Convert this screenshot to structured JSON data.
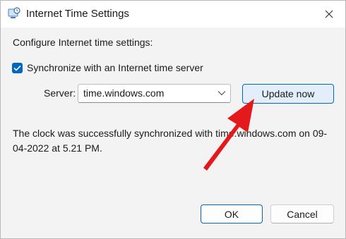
{
  "window": {
    "title": "Internet Time Settings",
    "close_icon": "close-icon",
    "app_icon": "clock-settings-icon"
  },
  "section": {
    "heading": "Configure Internet time settings:"
  },
  "sync": {
    "label": "Synchronize with an Internet time server",
    "checked": true
  },
  "server": {
    "label": "Server:",
    "value": "time.windows.com"
  },
  "buttons": {
    "update": "Update now",
    "ok": "OK",
    "cancel": "Cancel"
  },
  "status": {
    "message": "The clock was successfully synchronized with time.windows.com on 09-04-2022 at 5.21 PM."
  },
  "colors": {
    "accent": "#0067c0",
    "annotation_arrow": "#e3191b"
  }
}
